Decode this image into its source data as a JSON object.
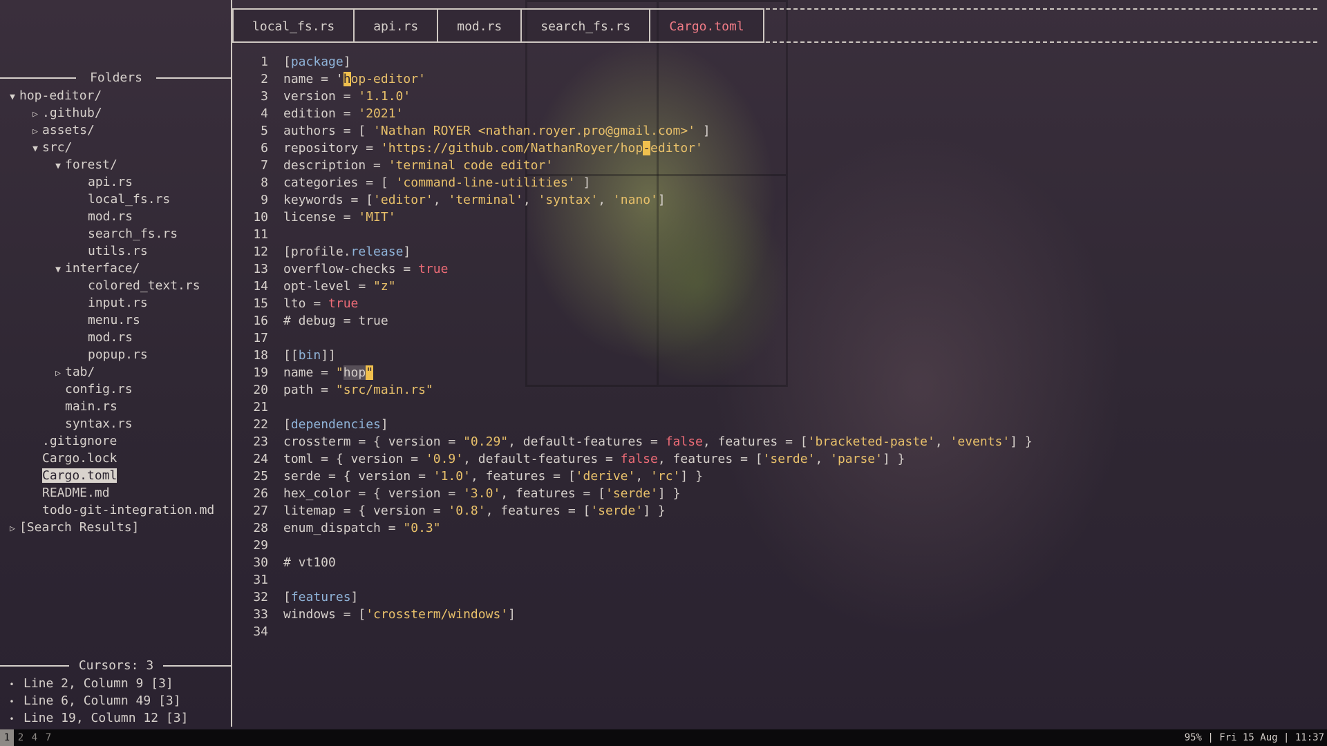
{
  "sidebar": {
    "folders_title": "Folders",
    "tree": [
      {
        "label": "hop-editor/",
        "arrow": "down",
        "depth": 0
      },
      {
        "label": ".github/",
        "arrow": "right",
        "depth": 1
      },
      {
        "label": "assets/",
        "arrow": "right",
        "depth": 1
      },
      {
        "label": "src/",
        "arrow": "down",
        "depth": 1
      },
      {
        "label": "forest/",
        "arrow": "down",
        "depth": 2
      },
      {
        "label": "api.rs",
        "arrow": "",
        "depth": 3
      },
      {
        "label": "local_fs.rs",
        "arrow": "",
        "depth": 3
      },
      {
        "label": "mod.rs",
        "arrow": "",
        "depth": 3
      },
      {
        "label": "search_fs.rs",
        "arrow": "",
        "depth": 3
      },
      {
        "label": "utils.rs",
        "arrow": "",
        "depth": 3
      },
      {
        "label": "interface/",
        "arrow": "down",
        "depth": 2
      },
      {
        "label": "colored_text.rs",
        "arrow": "",
        "depth": 3
      },
      {
        "label": "input.rs",
        "arrow": "",
        "depth": 3
      },
      {
        "label": "menu.rs",
        "arrow": "",
        "depth": 3
      },
      {
        "label": "mod.rs",
        "arrow": "",
        "depth": 3
      },
      {
        "label": "popup.rs",
        "arrow": "",
        "depth": 3
      },
      {
        "label": "tab/",
        "arrow": "right",
        "depth": 2
      },
      {
        "label": "config.rs",
        "arrow": "",
        "depth": 2
      },
      {
        "label": "main.rs",
        "arrow": "",
        "depth": 2
      },
      {
        "label": "syntax.rs",
        "arrow": "",
        "depth": 2
      },
      {
        "label": ".gitignore",
        "arrow": "",
        "depth": 1
      },
      {
        "label": "Cargo.lock",
        "arrow": "",
        "depth": 1
      },
      {
        "label": "Cargo.toml",
        "arrow": "",
        "depth": 1,
        "selected": true
      },
      {
        "label": "README.md",
        "arrow": "",
        "depth": 1
      },
      {
        "label": "todo-git-integration.md",
        "arrow": "",
        "depth": 1
      },
      {
        "label": "[Search Results]",
        "arrow": "right",
        "depth": 0
      }
    ],
    "cursors_title": "Cursors: 3",
    "cursors": [
      "Line 2, Column 9 [3]",
      "Line 6, Column 49 [3]",
      "Line 19, Column 12 [3]"
    ]
  },
  "tabs": [
    {
      "label": "local_fs.rs",
      "active": false
    },
    {
      "label": "api.rs",
      "active": false
    },
    {
      "label": "mod.rs",
      "active": false
    },
    {
      "label": "search_fs.rs",
      "active": false
    },
    {
      "label": "Cargo.toml",
      "active": true
    }
  ],
  "editor": {
    "lines": [
      [
        [
          "[",
          "p"
        ],
        [
          "package",
          "k"
        ],
        [
          "]",
          "p"
        ]
      ],
      [
        [
          "name = '",
          "p"
        ],
        [
          "h",
          "c"
        ],
        [
          "op-editor'",
          "s"
        ]
      ],
      [
        [
          "version = ",
          "p"
        ],
        [
          "'1.1.0'",
          "s"
        ]
      ],
      [
        [
          "edition = ",
          "p"
        ],
        [
          "'2021'",
          "s"
        ]
      ],
      [
        [
          "authors = [ ",
          "p"
        ],
        [
          "'Nathan ROYER <nathan.royer.pro@gmail.com>'",
          "s"
        ],
        [
          " ]",
          "p"
        ]
      ],
      [
        [
          "repository = ",
          "p"
        ],
        [
          "'https://github.com/NathanRoyer/hop",
          "s"
        ],
        [
          "-",
          "c"
        ],
        [
          "editor'",
          "s"
        ]
      ],
      [
        [
          "description = ",
          "p"
        ],
        [
          "'terminal code editor'",
          "s"
        ]
      ],
      [
        [
          "categories = [ ",
          "p"
        ],
        [
          "'command-line-utilities'",
          "s"
        ],
        [
          " ]",
          "p"
        ]
      ],
      [
        [
          "keywords = [",
          "p"
        ],
        [
          "'editor'",
          "s"
        ],
        [
          ", ",
          "p"
        ],
        [
          "'terminal'",
          "s"
        ],
        [
          ", ",
          "p"
        ],
        [
          "'syntax'",
          "s"
        ],
        [
          ", ",
          "p"
        ],
        [
          "'nano'",
          "s"
        ],
        [
          "]",
          "p"
        ]
      ],
      [
        [
          "license = ",
          "p"
        ],
        [
          "'MIT'",
          "s"
        ]
      ],
      [],
      [
        [
          "[profile.",
          "p"
        ],
        [
          "release",
          "k"
        ],
        [
          "]",
          "p"
        ]
      ],
      [
        [
          "overflow-checks = ",
          "p"
        ],
        [
          "true",
          "b"
        ]
      ],
      [
        [
          "opt-level = ",
          "p"
        ],
        [
          "\"z\"",
          "s"
        ]
      ],
      [
        [
          "lto = ",
          "p"
        ],
        [
          "true",
          "b"
        ]
      ],
      [
        [
          "# debug = true",
          "p"
        ]
      ],
      [],
      [
        [
          "[[",
          "p"
        ],
        [
          "bin",
          "k"
        ],
        [
          "]]",
          "p"
        ]
      ],
      [
        [
          "name = ",
          "p"
        ],
        [
          "\"",
          "s"
        ],
        [
          "hop",
          "h"
        ],
        [
          "\"",
          "c"
        ]
      ],
      [
        [
          "path = ",
          "p"
        ],
        [
          "\"src/main.rs\"",
          "s"
        ]
      ],
      [],
      [
        [
          "[",
          "p"
        ],
        [
          "dependencies",
          "k"
        ],
        [
          "]",
          "p"
        ]
      ],
      [
        [
          "crossterm = { version = ",
          "p"
        ],
        [
          "\"0.29\"",
          "s"
        ],
        [
          ", default-features = ",
          "p"
        ],
        [
          "false",
          "b"
        ],
        [
          ", features = [",
          "p"
        ],
        [
          "'bracketed-paste'",
          "s"
        ],
        [
          ", ",
          "p"
        ],
        [
          "'events'",
          "s"
        ],
        [
          "] }",
          "p"
        ]
      ],
      [
        [
          "toml = { version = ",
          "p"
        ],
        [
          "'0.9'",
          "s"
        ],
        [
          ", default-features = ",
          "p"
        ],
        [
          "false",
          "b"
        ],
        [
          ", features = [",
          "p"
        ],
        [
          "'serde'",
          "s"
        ],
        [
          ", ",
          "p"
        ],
        [
          "'parse'",
          "s"
        ],
        [
          "] }",
          "p"
        ]
      ],
      [
        [
          "serde = { version = ",
          "p"
        ],
        [
          "'1.0'",
          "s"
        ],
        [
          ", features = [",
          "p"
        ],
        [
          "'derive'",
          "s"
        ],
        [
          ", ",
          "p"
        ],
        [
          "'rc'",
          "s"
        ],
        [
          "] }",
          "p"
        ]
      ],
      [
        [
          "hex_color = { version = ",
          "p"
        ],
        [
          "'3.0'",
          "s"
        ],
        [
          ", features = [",
          "p"
        ],
        [
          "'serde'",
          "s"
        ],
        [
          "] }",
          "p"
        ]
      ],
      [
        [
          "litemap = { version = ",
          "p"
        ],
        [
          "'0.8'",
          "s"
        ],
        [
          ", features = [",
          "p"
        ],
        [
          "'serde'",
          "s"
        ],
        [
          "] }",
          "p"
        ]
      ],
      [
        [
          "enum_dispatch = ",
          "p"
        ],
        [
          "\"0.3\"",
          "s"
        ]
      ],
      [],
      [
        [
          "# vt100",
          "p"
        ]
      ],
      [],
      [
        [
          "[",
          "p"
        ],
        [
          "features",
          "k"
        ],
        [
          "]",
          "p"
        ]
      ],
      [
        [
          "windows = [",
          "p"
        ],
        [
          "'crossterm/windows'",
          "s"
        ],
        [
          "]",
          "p"
        ]
      ],
      []
    ]
  },
  "statusbar": {
    "workspaces": [
      {
        "label": "1",
        "active": true
      },
      {
        "label": "2",
        "active": false
      },
      {
        "label": "4",
        "active": false
      },
      {
        "label": "7",
        "active": false
      }
    ],
    "right": "95% | Fri 15 Aug | 11:37"
  },
  "colors": {
    "accent_tab": "#f07b86",
    "keyword": "#8fb3d8",
    "string": "#e8c06a",
    "boolean": "#ee6c77",
    "cursor": "#f0c04e"
  }
}
